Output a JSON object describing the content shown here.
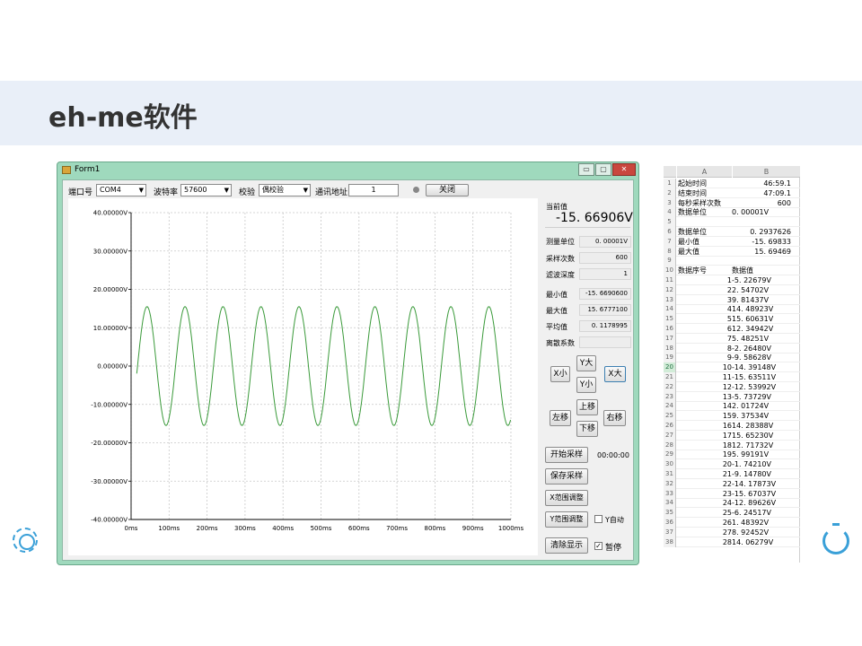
{
  "slide": {
    "title": "eh-me软件"
  },
  "window": {
    "title": "Form1",
    "min": "▭",
    "max": "▢",
    "close": "✕"
  },
  "toolbar": {
    "port_label": "端口号",
    "port_value": "COM4",
    "baud_label": "波特率",
    "baud_value": "57600",
    "parity_label": "校验",
    "parity_value": "偶校验",
    "addr_label": "通讯地址",
    "addr_value": "1",
    "close_button": "关闭"
  },
  "chart_data": {
    "type": "line",
    "title": "",
    "xlabel": "",
    "ylabel": "",
    "x_ticks": [
      "0ms",
      "100ms",
      "200ms",
      "300ms",
      "400ms",
      "500ms",
      "600ms",
      "700ms",
      "800ms",
      "900ms",
      "1000ms"
    ],
    "y_ticks": [
      "40.00000V",
      "30.00000V",
      "20.00000V",
      "10.00000V",
      "0.00000V",
      "-10.00000V",
      "-20.00000V",
      "-30.00000V",
      "-40.00000V"
    ],
    "xlim": [
      0,
      1000
    ],
    "ylim": [
      -40,
      40
    ],
    "grid": true,
    "series": [
      {
        "color": "#3a9a3a",
        "amplitude": 15.5,
        "period_ms": 100,
        "phase_ms": -17,
        "note_points": "sine wave ~15.5V amplitude, 100ms period, starting near -9V at 15ms"
      }
    ]
  },
  "panel": {
    "current_label": "当前值",
    "current_value": "-15. 66906V",
    "unit_label": "测量单位",
    "unit_value": "0. 00001V",
    "count_label": "采样次数",
    "count_value": "600",
    "filter_label": "滤波深度",
    "filter_value": "1",
    "min_label": "最小值",
    "min_value": "-15. 6690600",
    "max_label": "最大值",
    "max_value": "15. 6777100",
    "avg_label": "平均值",
    "avg_value": "0. 1178995",
    "disp_label": "离散系数",
    "disp_value": "",
    "x_small": "X小",
    "y_big": "Y大",
    "y_small": "Y小",
    "x_big": "X大",
    "left_move": "左移",
    "up_move": "上移",
    "down_move": "下移",
    "right_move": "右移",
    "start_button": "开始采样",
    "timer": "00:00:00",
    "save_button": "保存采样",
    "x_range_button": "X范围调整",
    "y_range_button": "Y范围调整",
    "y_auto_label": "Y自动",
    "clear_button": "清除显示",
    "pause_label": "暂停",
    "pause_check": "✓"
  },
  "sheet": {
    "col_a": "A",
    "col_b": "B",
    "rows": [
      {
        "n": "1",
        "a": "起始时间",
        "b": "46:59.1",
        "br": true
      },
      {
        "n": "2",
        "a": "结束时间",
        "b": "47:09.1",
        "br": true
      },
      {
        "n": "3",
        "a": "每秒采样次数",
        "b": "600",
        "br": true
      },
      {
        "n": "4",
        "a": "数据单位",
        "b": "0. 00001V",
        "br": false
      },
      {
        "n": "5",
        "a": "",
        "b": "",
        "br": true
      },
      {
        "n": "6",
        "a": "数据单位",
        "b": "0. 2937626",
        "br": true
      },
      {
        "n": "7",
        "a": "最小值",
        "b": "-15. 69833",
        "br": true
      },
      {
        "n": "8",
        "a": "最大值",
        "b": "15. 69469",
        "br": true
      },
      {
        "n": "9",
        "a": "",
        "b": "",
        "br": true
      },
      {
        "n": "10",
        "a": "数据序号",
        "b": "数据值",
        "br": false
      },
      {
        "n": "11",
        "a": "1",
        "b": "-5. 22679V",
        "br": false,
        "ar": true
      },
      {
        "n": "12",
        "a": "2",
        "b": "2. 54702V",
        "br": false,
        "ar": true
      },
      {
        "n": "13",
        "a": "3",
        "b": "9. 81437V",
        "br": false,
        "ar": true
      },
      {
        "n": "14",
        "a": "4",
        "b": "14. 48923V",
        "br": false,
        "ar": true
      },
      {
        "n": "15",
        "a": "5",
        "b": "15. 60631V",
        "br": false,
        "ar": true
      },
      {
        "n": "16",
        "a": "6",
        "b": "12. 34942V",
        "br": false,
        "ar": true
      },
      {
        "n": "17",
        "a": "7",
        "b": "5. 48251V",
        "br": false,
        "ar": true
      },
      {
        "n": "18",
        "a": "8",
        "b": "-2. 26480V",
        "br": false,
        "ar": true
      },
      {
        "n": "19",
        "a": "9",
        "b": "-9. 58628V",
        "br": false,
        "ar": true
      },
      {
        "n": "20",
        "a": "10",
        "b": "-14. 39148V",
        "br": false,
        "ar": true,
        "sel": true
      },
      {
        "n": "21",
        "a": "11",
        "b": "-15. 63511V",
        "br": false,
        "ar": true
      },
      {
        "n": "22",
        "a": "12",
        "b": "-12. 53992V",
        "br": false,
        "ar": true
      },
      {
        "n": "23",
        "a": "13",
        "b": "-5. 73729V",
        "br": false,
        "ar": true
      },
      {
        "n": "24",
        "a": "14",
        "b": "2. 01724V",
        "br": false,
        "ar": true
      },
      {
        "n": "25",
        "a": "15",
        "b": "9. 37534V",
        "br": false,
        "ar": true
      },
      {
        "n": "26",
        "a": "16",
        "b": "14. 28388V",
        "br": false,
        "ar": true
      },
      {
        "n": "27",
        "a": "17",
        "b": "15. 65230V",
        "br": false,
        "ar": true
      },
      {
        "n": "28",
        "a": "18",
        "b": "12. 71732V",
        "br": false,
        "ar": true
      },
      {
        "n": "29",
        "a": "19",
        "b": "5. 99191V",
        "br": false,
        "ar": true
      },
      {
        "n": "30",
        "a": "20",
        "b": "-1. 74210V",
        "br": false,
        "ar": true
      },
      {
        "n": "31",
        "a": "21",
        "b": "-9. 14780V",
        "br": false,
        "ar": true
      },
      {
        "n": "32",
        "a": "22",
        "b": "-14. 17873V",
        "br": false,
        "ar": true
      },
      {
        "n": "33",
        "a": "23",
        "b": "-15. 67037V",
        "br": false,
        "ar": true
      },
      {
        "n": "34",
        "a": "24",
        "b": "-12. 89626V",
        "br": false,
        "ar": true
      },
      {
        "n": "35",
        "a": "25",
        "b": "-6. 24517V",
        "br": false,
        "ar": true
      },
      {
        "n": "36",
        "a": "26",
        "b": "1. 48392V",
        "br": false,
        "ar": true
      },
      {
        "n": "37",
        "a": "27",
        "b": "8. 92452V",
        "br": false,
        "ar": true
      },
      {
        "n": "38",
        "a": "28",
        "b": "14. 06279V",
        "br": false,
        "ar": true
      }
    ]
  }
}
